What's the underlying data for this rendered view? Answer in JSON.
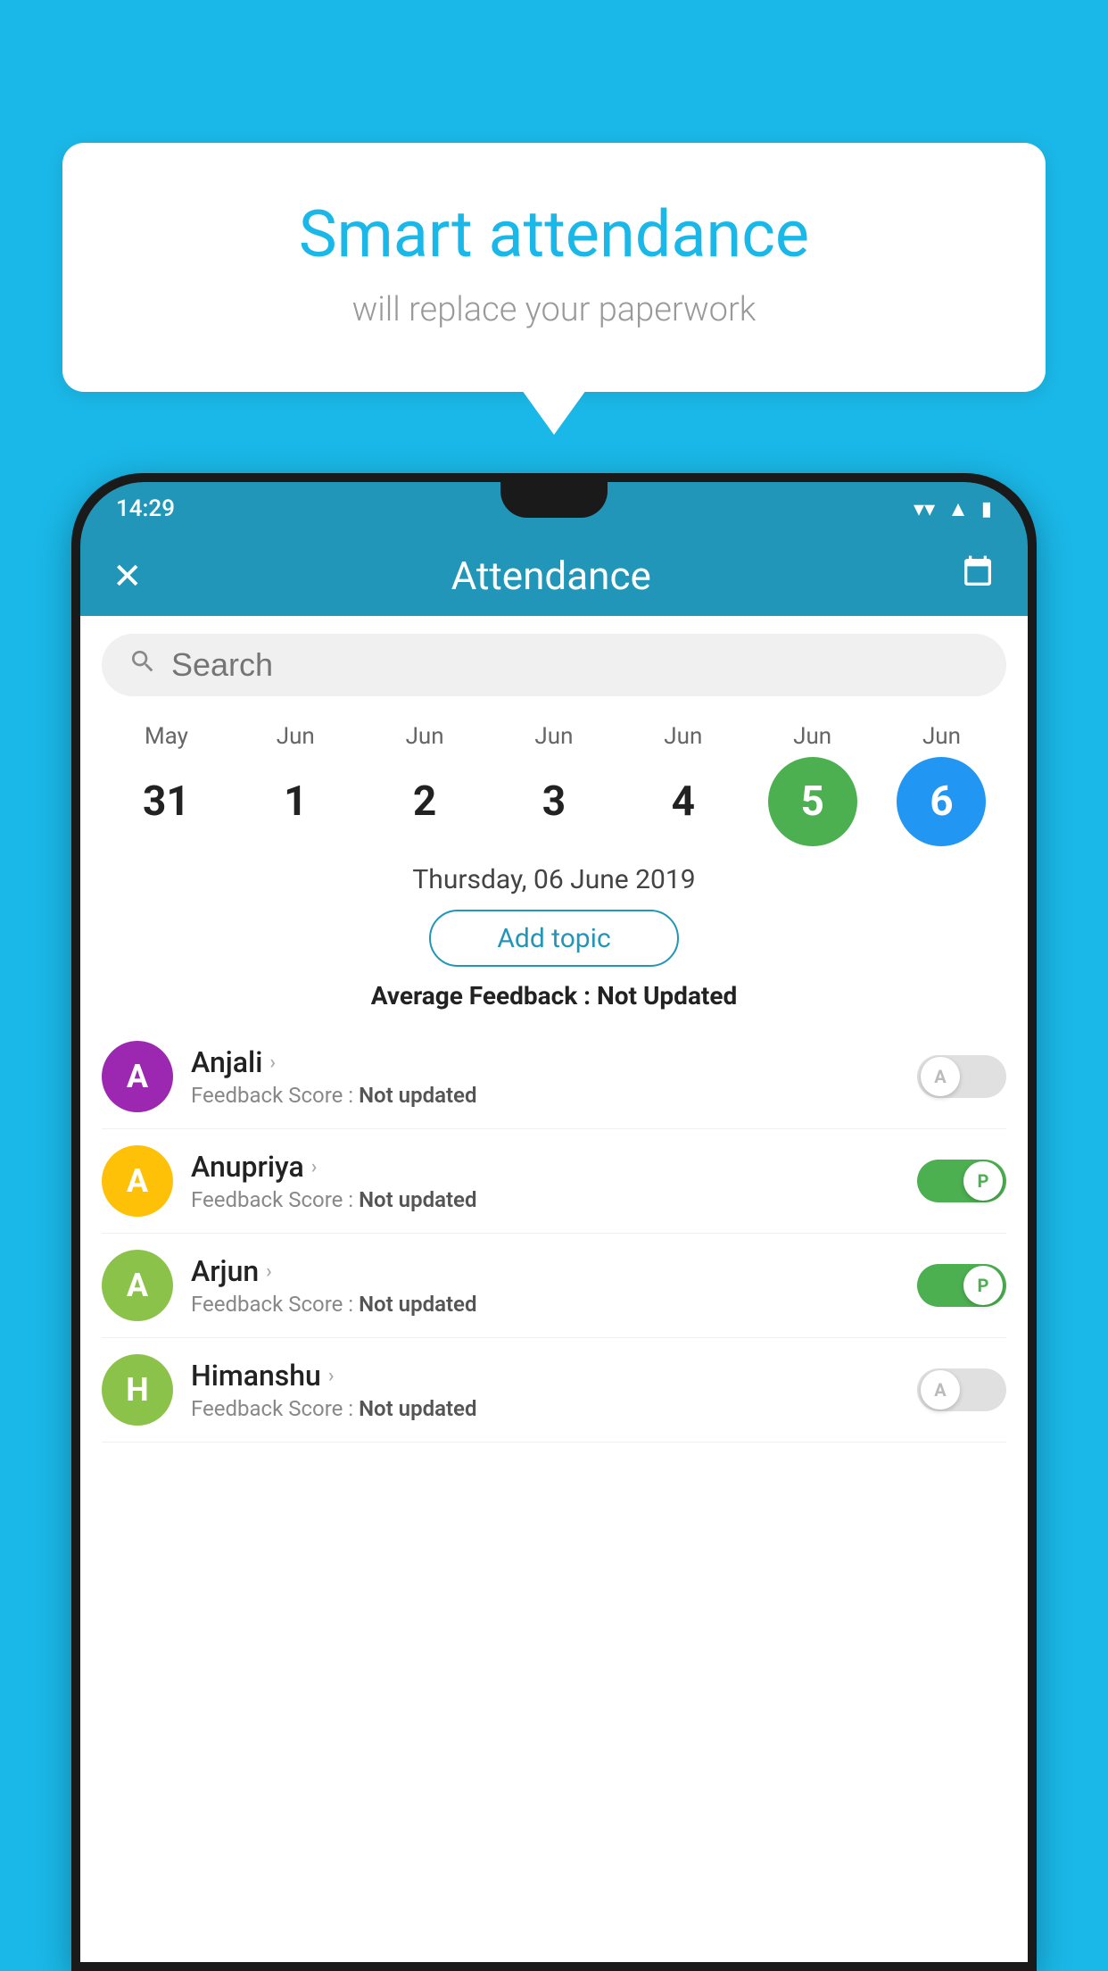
{
  "background_color": "#1ab8e8",
  "bubble": {
    "title": "Smart attendance",
    "subtitle": "will replace your paperwork"
  },
  "status_bar": {
    "time": "14:29",
    "wifi": "▼",
    "signal": "▲",
    "battery": "▮"
  },
  "header": {
    "title": "Attendance",
    "close_label": "✕",
    "calendar_label": "📅"
  },
  "search": {
    "placeholder": "Search"
  },
  "calendar": {
    "days": [
      {
        "month": "May",
        "date": "31",
        "state": "normal"
      },
      {
        "month": "Jun",
        "date": "1",
        "state": "normal"
      },
      {
        "month": "Jun",
        "date": "2",
        "state": "normal"
      },
      {
        "month": "Jun",
        "date": "3",
        "state": "normal"
      },
      {
        "month": "Jun",
        "date": "4",
        "state": "normal"
      },
      {
        "month": "Jun",
        "date": "5",
        "state": "today"
      },
      {
        "month": "Jun",
        "date": "6",
        "state": "selected"
      }
    ]
  },
  "selected_date": "Thursday, 06 June 2019",
  "add_topic_label": "Add topic",
  "avg_feedback_label": "Average Feedback : ",
  "avg_feedback_value": "Not Updated",
  "students": [
    {
      "name": "Anjali",
      "avatar_letter": "A",
      "avatar_color": "#9c27b0",
      "feedback_label": "Feedback Score : ",
      "feedback_value": "Not updated",
      "toggle_state": "off",
      "toggle_letter": "A"
    },
    {
      "name": "Anupriya",
      "avatar_letter": "A",
      "avatar_color": "#ffc107",
      "feedback_label": "Feedback Score : ",
      "feedback_value": "Not updated",
      "toggle_state": "on",
      "toggle_letter": "P"
    },
    {
      "name": "Arjun",
      "avatar_letter": "A",
      "avatar_color": "#8bc34a",
      "feedback_label": "Feedback Score : ",
      "feedback_value": "Not updated",
      "toggle_state": "on",
      "toggle_letter": "P"
    },
    {
      "name": "Himanshu",
      "avatar_letter": "H",
      "avatar_color": "#8bc34a",
      "feedback_label": "Feedback Score : ",
      "feedback_value": "Not updated",
      "toggle_state": "off",
      "toggle_letter": "A"
    }
  ]
}
